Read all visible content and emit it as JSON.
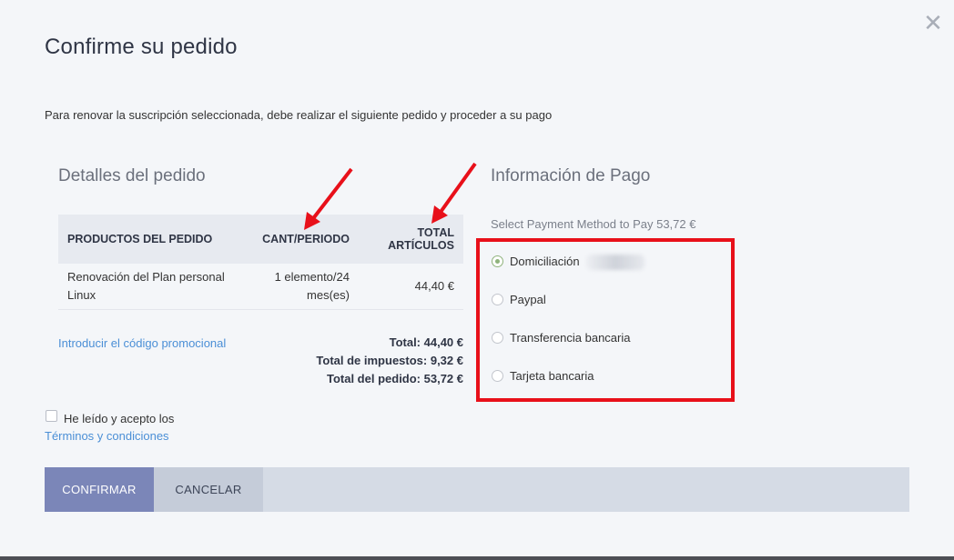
{
  "modal": {
    "title": "Confirme su pedido",
    "intro": "Para renovar la suscripción seleccionada, debe realizar el siguiente pedido y proceder a su pago",
    "close_icon": "close-icon"
  },
  "order": {
    "section_title": "Detalles del pedido",
    "columns": [
      "PRODUCTOS DEL PEDIDO",
      "CANT/PERIODO",
      "TOTAL ARTÍCULOS"
    ],
    "rows": [
      {
        "product": "Renovación del Plan personal Linux",
        "qty": "1 elemento/24 mes(es)",
        "total": "44,40 €"
      }
    ],
    "promo_link": "Introducir el código promocional",
    "totals": {
      "total": "Total: 44,40 €",
      "tax": "Total de impuestos: 9,32 €",
      "order_total": "Total del pedido: 53,72 €"
    }
  },
  "terms": {
    "text": "He leído y acepto los",
    "link": "Términos y condiciones",
    "checked": false
  },
  "payment": {
    "section_title": "Información de Pago",
    "subtitle": "Select Payment Method to Pay 53,72 €",
    "options": [
      {
        "label": "Domiciliación",
        "selected": true
      },
      {
        "label": "Paypal",
        "selected": false
      },
      {
        "label": "Transferencia bancaria",
        "selected": false
      },
      {
        "label": "Tarjeta bancaria",
        "selected": false
      }
    ],
    "highlight_color": "#e8101a"
  },
  "buttons": {
    "confirm": "CONFIRMAR",
    "cancel": "CANCELAR"
  },
  "colors": {
    "accent": "#7b86b8",
    "link": "#4b8fd6",
    "annotation": "#e8101a"
  }
}
